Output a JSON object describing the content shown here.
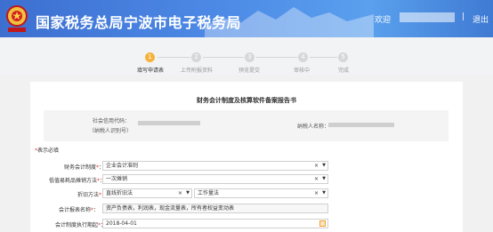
{
  "header": {
    "title": "国家税务总局宁波市电子税务局",
    "welcome": "欢迎",
    "separator": "|",
    "logout": "退出"
  },
  "steps": [
    {
      "number": "1",
      "label": "填写申请表",
      "active": true
    },
    {
      "number": "2",
      "label": "上传附报资料",
      "active": false
    },
    {
      "number": "3",
      "label": "预览提交",
      "active": false
    },
    {
      "number": "4",
      "label": "审核中",
      "active": false
    },
    {
      "number": "5",
      "label": "完成",
      "active": false
    }
  ],
  "form": {
    "title": "财务会计制度及核算软件备案报告书",
    "credit_code_label_1": "社会信用代码：",
    "credit_code_label_2": "（纳税人识别号）",
    "taxpayer_name_label": "纳税人名称：",
    "required_note": "表示必填",
    "fields": {
      "accounting_system": {
        "label": "财务会计制度",
        "value": "企业会计准则"
      },
      "amortization_method": {
        "label": "低值易耗品摊销方法",
        "value": "一次摊销"
      },
      "depreciation_method": {
        "label": "折旧方法",
        "value": "直线折旧法",
        "value2": "工作量法"
      },
      "statement_name": {
        "label": "会计报表名称",
        "value": "资产负债表，利润表，现金流量表，所有者权益变动表"
      },
      "execution_date": {
        "label": "会计制度执行期起",
        "value": "2018-04-01"
      }
    }
  }
}
